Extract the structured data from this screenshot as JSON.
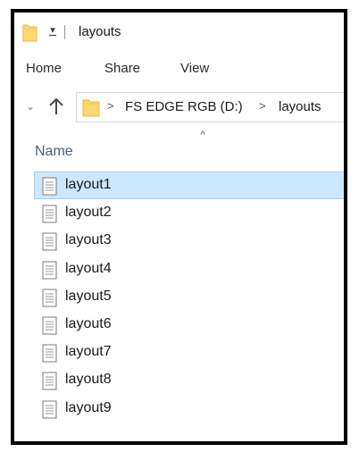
{
  "window": {
    "title": "layouts",
    "title_icon": "folder-icon",
    "qa_icon": "customize-toolbar-icon"
  },
  "ribbon": {
    "tabs": [
      {
        "label": "Home"
      },
      {
        "label": "Share"
      },
      {
        "label": "View"
      }
    ]
  },
  "nav": {
    "recent_icon": "chevron-down-icon",
    "up_icon": "up-arrow-icon",
    "breadcrumb": [
      {
        "label": "FS EDGE RGB (D:)"
      },
      {
        "label": "layouts"
      }
    ],
    "separator_icon": "chevron-right-icon"
  },
  "columns": {
    "name_header": "Name",
    "sort_icon": "sort-ascending-icon"
  },
  "files": [
    {
      "name": "layout1",
      "selected": true
    },
    {
      "name": "layout2",
      "selected": false
    },
    {
      "name": "layout3",
      "selected": false
    },
    {
      "name": "layout4",
      "selected": false
    },
    {
      "name": "layout5",
      "selected": false
    },
    {
      "name": "layout6",
      "selected": false
    },
    {
      "name": "layout7",
      "selected": false
    },
    {
      "name": "layout8",
      "selected": false
    },
    {
      "name": "layout9",
      "selected": false
    }
  ],
  "colors": {
    "folder": "#ffd86e",
    "selection_bg": "#cce8ff",
    "selection_border": "#99d1ff",
    "header_text": "#4a5e75"
  }
}
